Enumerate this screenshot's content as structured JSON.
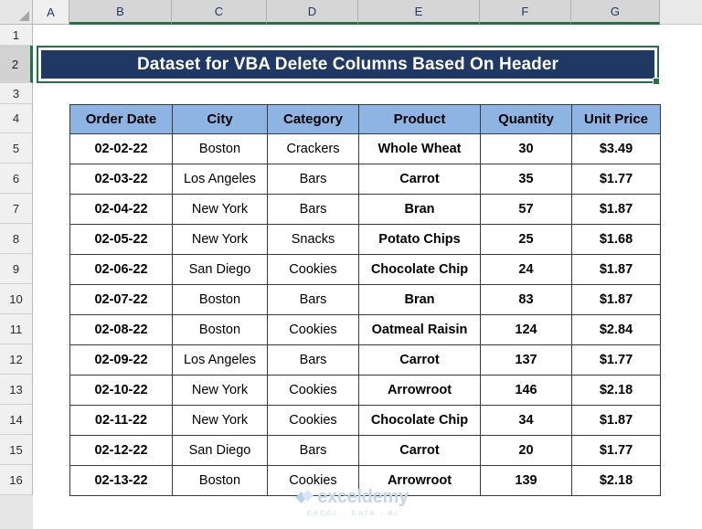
{
  "app": {
    "type": "spreadsheet",
    "colors": {
      "title_banner_bg": "#1F3864",
      "title_banner_text": "#FFFFFF",
      "table_header_bg": "#8DB4E2",
      "selection_border": "#217346",
      "grid_line": "#3A3A3A"
    }
  },
  "grid": {
    "column_headers": [
      "A",
      "B",
      "C",
      "D",
      "E",
      "F",
      "G"
    ],
    "selected_columns": [
      "B",
      "C",
      "D",
      "E",
      "F",
      "G"
    ],
    "row_headers": [
      "1",
      "2",
      "3",
      "4",
      "5",
      "6",
      "7",
      "8",
      "9",
      "10",
      "11",
      "12",
      "13",
      "14",
      "15",
      "16"
    ],
    "selected_row": "2"
  },
  "title_banner": {
    "text": "Dataset for VBA Delete Columns Based On Header",
    "merged_range": "B2:G2"
  },
  "table": {
    "headers": [
      "Order Date",
      "City",
      "Category",
      "Product",
      "Quantity",
      "Unit Price"
    ],
    "rows": [
      [
        "02-02-22",
        "Boston",
        "Crackers",
        "Whole Wheat",
        "30",
        "$3.49"
      ],
      [
        "02-03-22",
        "Los Angeles",
        "Bars",
        "Carrot",
        "35",
        "$1.77"
      ],
      [
        "02-04-22",
        "New York",
        "Bars",
        "Bran",
        "57",
        "$1.87"
      ],
      [
        "02-05-22",
        "New York",
        "Snacks",
        "Potato Chips",
        "25",
        "$1.68"
      ],
      [
        "02-06-22",
        "San Diego",
        "Cookies",
        "Chocolate Chip",
        "24",
        "$1.87"
      ],
      [
        "02-07-22",
        "Boston",
        "Bars",
        "Bran",
        "83",
        "$1.87"
      ],
      [
        "02-08-22",
        "Boston",
        "Cookies",
        "Oatmeal Raisin",
        "124",
        "$2.84"
      ],
      [
        "02-09-22",
        "Los Angeles",
        "Bars",
        "Carrot",
        "137",
        "$1.77"
      ],
      [
        "02-10-22",
        "New York",
        "Cookies",
        "Arrowroot",
        "146",
        "$2.18"
      ],
      [
        "02-11-22",
        "New York",
        "Cookies",
        "Chocolate Chip",
        "34",
        "$1.87"
      ],
      [
        "02-12-22",
        "San Diego",
        "Bars",
        "Carrot",
        "20",
        "$1.77"
      ],
      [
        "02-13-22",
        "Boston",
        "Cookies",
        "Arrowroot",
        "139",
        "$2.18"
      ]
    ]
  },
  "watermark": {
    "name": "exceldemy",
    "tagline": "EXCEL - DATA - BI"
  }
}
